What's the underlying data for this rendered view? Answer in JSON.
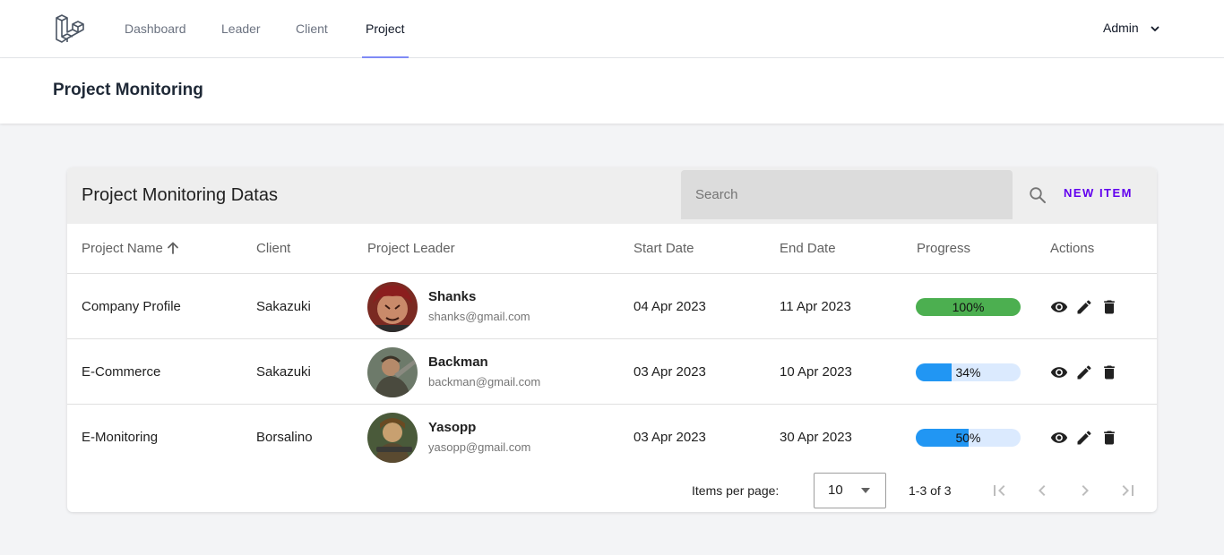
{
  "nav": {
    "logo_icon": "laravel-logo-icon",
    "items": [
      {
        "label": "Dashboard",
        "active": false
      },
      {
        "label": "Leader",
        "active": false
      },
      {
        "label": "Client",
        "active": false
      },
      {
        "label": "Project",
        "active": true
      }
    ],
    "user": {
      "label": "Admin",
      "icon": "chevron-down-icon"
    }
  },
  "header": {
    "title": "Project Monitoring"
  },
  "table": {
    "title": "Project Monitoring Datas",
    "search": {
      "placeholder": "Search",
      "value": "",
      "icon": "search-icon"
    },
    "new_item_label": "NEW ITEM",
    "columns": [
      "Project Name",
      "Client",
      "Project Leader",
      "Start Date",
      "End Date",
      "Progress",
      "Actions"
    ],
    "sort": {
      "column": "Project Name",
      "direction": "asc",
      "icon": "arrow-up-icon"
    },
    "rows": [
      {
        "project": "Company Profile",
        "client": "Sakazuki",
        "leader": {
          "name": "Shanks",
          "email": "shanks@gmail.com"
        },
        "start": "04 Apr 2023",
        "end": "11 Apr 2023",
        "progress": 100,
        "progress_label": "100%"
      },
      {
        "project": "E-Commerce",
        "client": "Sakazuki",
        "leader": {
          "name": "Backman",
          "email": "backman@gmail.com"
        },
        "start": "03 Apr 2023",
        "end": "10 Apr 2023",
        "progress": 34,
        "progress_label": "34%"
      },
      {
        "project": "E-Monitoring",
        "client": "Borsalino",
        "leader": {
          "name": "Yasopp",
          "email": "yasopp@gmail.com"
        },
        "start": "03 Apr 2023",
        "end": "30 Apr 2023",
        "progress": 50,
        "progress_label": "50%"
      }
    ],
    "action_icons": [
      "eye-icon",
      "pencil-icon",
      "trash-icon"
    ],
    "footer": {
      "items_per_page_label": "Items per page:",
      "items_per_page": "10",
      "range": "1-3 of 3",
      "pagination_icons": [
        "first-page-icon",
        "prev-page-icon",
        "next-page-icon",
        "last-page-icon"
      ]
    }
  },
  "colors": {
    "accent": "#6200ee",
    "nav_underline": "#818cf8",
    "progress_complete": "#4caf50",
    "progress_fill": "#2196f3",
    "progress_track": "#dbeafe"
  }
}
